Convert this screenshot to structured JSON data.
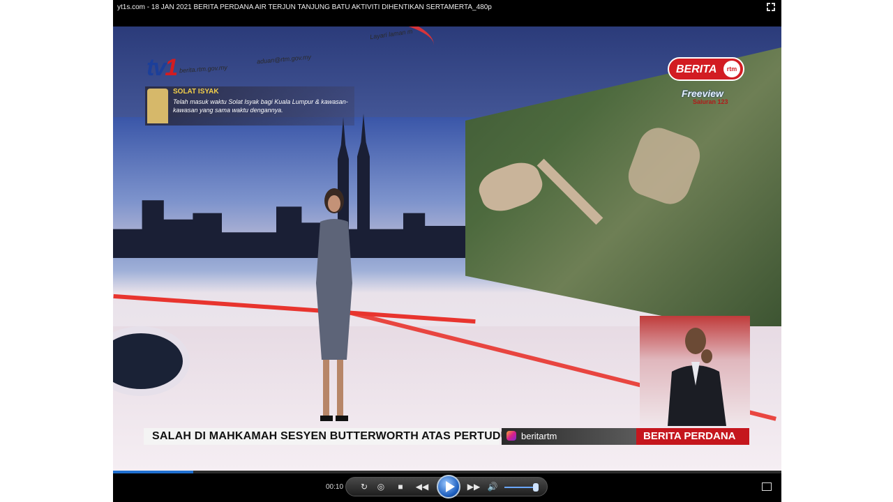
{
  "window": {
    "title": "yt1s.com - 18 JAN 2021  BERITA PERDANA  AIR TERJUN TANJUNG BATU  AKTIVITI DIHENTIKAN SERTAMERTA_480p"
  },
  "video": {
    "channel_logo": {
      "text": "tv",
      "number": "1"
    },
    "url_banner": [
      "berita.rtm.gov.my",
      "aduan@rtm.gov.my",
      "Layari laman m"
    ],
    "solat": {
      "title": "SOLAT ISYAK",
      "text": "Telah masuk waktu Solat Isyak bagi Kuala Lumpur & kawasan-kawasan yang sama waktu dengannya."
    },
    "berita_logo": {
      "text": "BERITA",
      "sub": "rtm"
    },
    "freeview": {
      "brand": "Freeview",
      "channel": "Saluran 123"
    },
    "ticker": {
      "headline": "SALAH DI MAHKAMAH SESYEN BUTTERWORTH ATAS PERTUDUH",
      "social": "beritartm",
      "program": "BERITA PERDANA"
    }
  },
  "controls": {
    "current_time": "00:10",
    "progress": 0.12,
    "volume": 0.85,
    "accent_color": "#1f6fd0",
    "icons": [
      "repeat-icon",
      "shuffle-icon",
      "stop-icon",
      "rewind-icon",
      "play-icon",
      "fast-forward-icon",
      "volume-icon",
      "mini-player-icon",
      "fullscreen-icon"
    ]
  }
}
